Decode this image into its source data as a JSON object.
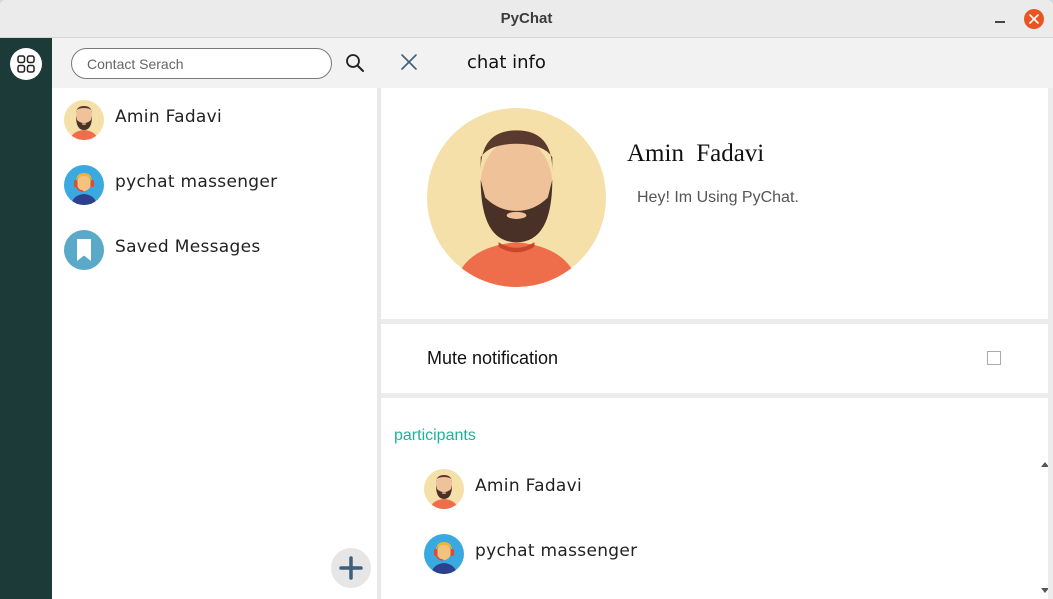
{
  "window": {
    "title": "PyChat"
  },
  "search": {
    "placeholder": "Contact Serach"
  },
  "contacts": [
    {
      "name": "Amin Fadavi",
      "avatar": "bearded-man-avatar"
    },
    {
      "name": "pychat massenger",
      "avatar": "support-agent-avatar"
    },
    {
      "name": "Saved Messages",
      "avatar": "bookmark-avatar"
    }
  ],
  "info": {
    "title": "chat info",
    "name": "Amin  Fadavi",
    "status": "Hey! Im Using PyChat."
  },
  "mute": {
    "label": "Mute notification",
    "checked": false
  },
  "participants": {
    "label": "participants",
    "items": [
      {
        "name": "Amin Fadavi",
        "avatar": "bearded-man-avatar"
      },
      {
        "name": "pychat massenger",
        "avatar": "support-agent-avatar"
      }
    ]
  },
  "colors": {
    "rail": "#1c3b38",
    "accent": "#1cb39b",
    "close": "#e95420"
  }
}
